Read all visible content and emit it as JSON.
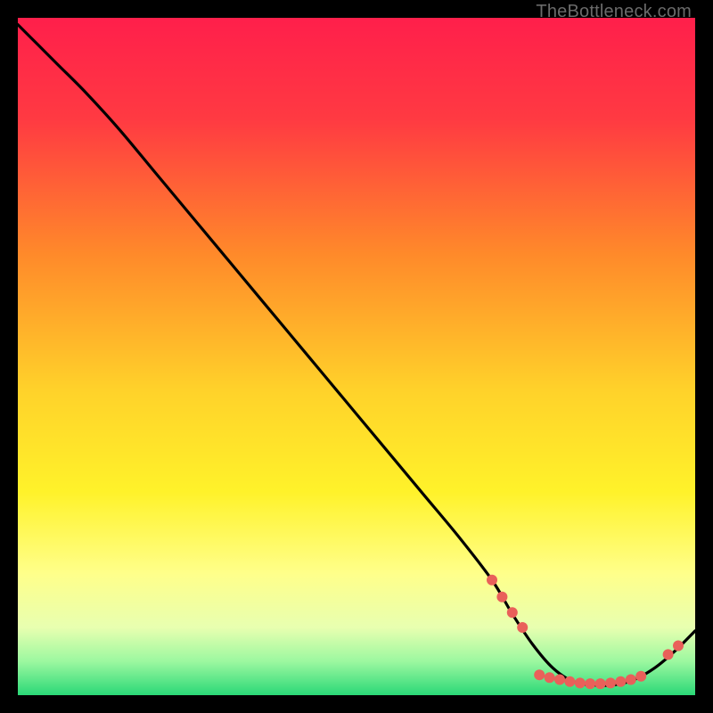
{
  "attribution": "TheBottleneck.com",
  "chart_data": {
    "type": "line",
    "title": "",
    "xlabel": "",
    "ylabel": "",
    "xlim": [
      0,
      100
    ],
    "ylim": [
      0,
      100
    ],
    "gradient_stops": [
      {
        "offset": 0.0,
        "color": "#ff1f4b"
      },
      {
        "offset": 0.15,
        "color": "#ff3a42"
      },
      {
        "offset": 0.35,
        "color": "#ff8a2a"
      },
      {
        "offset": 0.55,
        "color": "#ffd22a"
      },
      {
        "offset": 0.7,
        "color": "#fff22a"
      },
      {
        "offset": 0.82,
        "color": "#ffff8a"
      },
      {
        "offset": 0.9,
        "color": "#e8ffb0"
      },
      {
        "offset": 0.95,
        "color": "#9cf8a0"
      },
      {
        "offset": 1.0,
        "color": "#2ad877"
      }
    ],
    "series": [
      {
        "name": "bottleneck-curve",
        "x": [
          0,
          3,
          6,
          10,
          15,
          20,
          25,
          30,
          35,
          40,
          45,
          50,
          55,
          60,
          65,
          70,
          73,
          76,
          79,
          82,
          85,
          88,
          91,
          94,
          97,
          100
        ],
        "y": [
          99,
          96,
          93,
          89,
          83.5,
          77.5,
          71.5,
          65.5,
          59.5,
          53.5,
          47.5,
          41.5,
          35.5,
          29.5,
          23.5,
          17,
          12,
          7.5,
          4,
          2,
          1.5,
          1.5,
          2.3,
          4,
          6.5,
          9.5
        ]
      }
    ],
    "markers": {
      "name": "highlight-points",
      "color": "#e9605a",
      "radius": 6,
      "points": [
        {
          "x": 70.0,
          "y": 17.0
        },
        {
          "x": 71.5,
          "y": 14.5
        },
        {
          "x": 73.0,
          "y": 12.2
        },
        {
          "x": 74.5,
          "y": 10.0
        },
        {
          "x": 77.0,
          "y": 3.0
        },
        {
          "x": 78.5,
          "y": 2.6
        },
        {
          "x": 80.0,
          "y": 2.3
        },
        {
          "x": 81.5,
          "y": 2.0
        },
        {
          "x": 83.0,
          "y": 1.8
        },
        {
          "x": 84.5,
          "y": 1.7
        },
        {
          "x": 86.0,
          "y": 1.7
        },
        {
          "x": 87.5,
          "y": 1.8
        },
        {
          "x": 89.0,
          "y": 2.0
        },
        {
          "x": 90.5,
          "y": 2.3
        },
        {
          "x": 92.0,
          "y": 2.8
        },
        {
          "x": 96.0,
          "y": 6.0
        },
        {
          "x": 97.5,
          "y": 7.3
        }
      ]
    }
  }
}
